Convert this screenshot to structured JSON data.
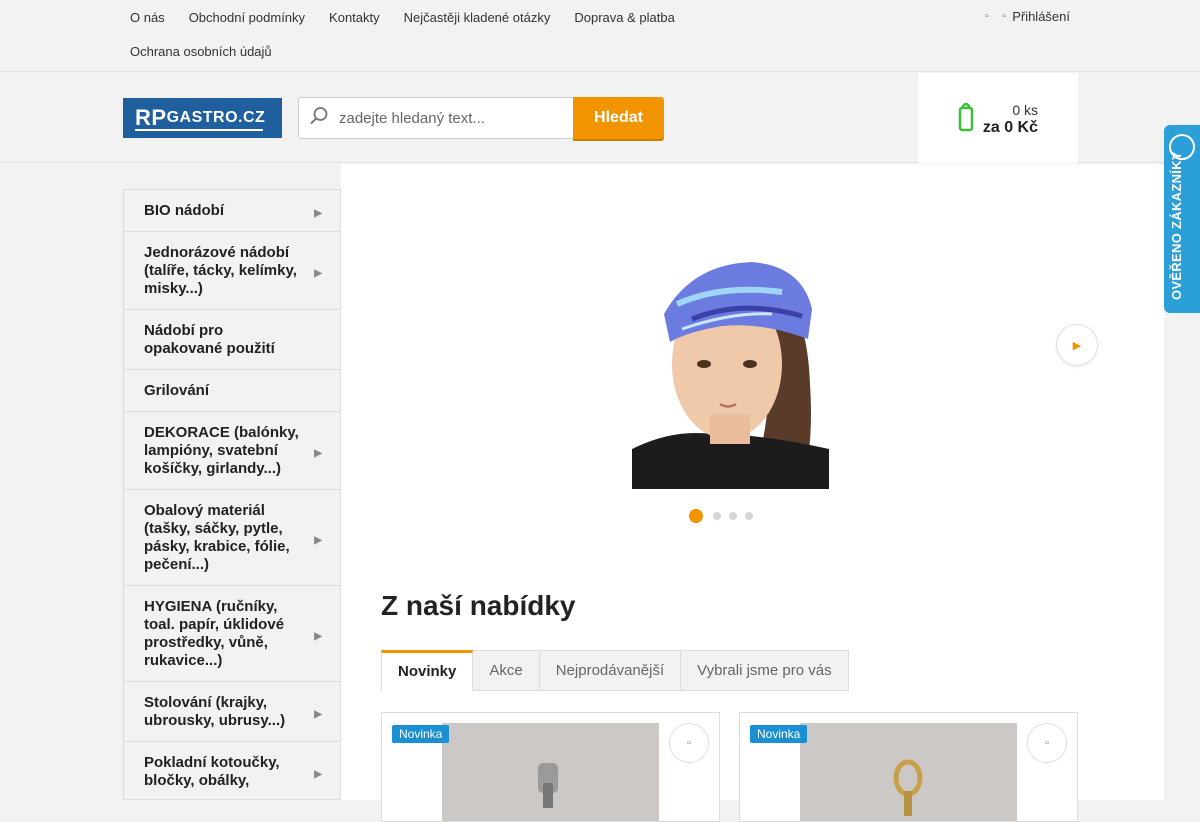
{
  "topnav": {
    "links": [
      "O nás",
      "Obchodní podmínky",
      "Kontakty",
      "Nejčastěji kladené otázky",
      "Doprava & platba",
      "Ochrana osobních údajů"
    ],
    "login_label": "Přihlášení"
  },
  "header": {
    "logo": {
      "big": "RP",
      "small": "GASTRO.CZ"
    },
    "search": {
      "placeholder": "zadejte hledaný text...",
      "button_label": "Hledat"
    },
    "cart": {
      "qty": "0 ks",
      "price": "za 0 Kč"
    }
  },
  "badge": {
    "text": "OVĚŘENO ZÁKAZNÍKY"
  },
  "sidebar": {
    "items": [
      {
        "label": "BIO nádobí",
        "has_arrow": true
      },
      {
        "label": "Jednorázové nádobí (talíře, tácky, kelímky, misky...)",
        "has_arrow": true
      },
      {
        "label": "Nádobí pro opakované použití",
        "has_arrow": false
      },
      {
        "label": "Grilování",
        "has_arrow": false
      },
      {
        "label": "DEKORACE (balónky, lampióny, svatební košíčky, girlandy...)",
        "has_arrow": true
      },
      {
        "label": "Obalový materiál (tašky, sáčky, pytle, pásky, krabice, fólie, pečení...)",
        "has_arrow": true
      },
      {
        "label": "HYGIENA (ručníky, toal. papír, úklidové prostředky, vůně, rukavice...)",
        "has_arrow": true
      },
      {
        "label": "Stolování (krajky, ubrousky, ubrusy...)",
        "has_arrow": true
      },
      {
        "label": "Pokladní kotoučky, bločky, obálky,",
        "has_arrow": true
      }
    ]
  },
  "slider": {
    "slide_count": 4,
    "active_slide": 1
  },
  "offer": {
    "title": "Z naší nabídky",
    "tabs": [
      "Novinky",
      "Akce",
      "Nejprodávanější",
      "Vybrali jsme pro vás"
    ],
    "active_tab": 0,
    "products": [
      {
        "badge": "Novinka"
      },
      {
        "badge": "Novinka"
      }
    ]
  },
  "colors": {
    "accent": "#f29400",
    "brand": "#1f5f9e",
    "badge": "#1a8fd2",
    "trust": "#2a9fd8",
    "cart_icon": "#3cbf3c"
  },
  "icons": {
    "search": "magnifier-icon",
    "login": "user-icon",
    "cart": "cart-icon",
    "next": "chevron-right-icon",
    "wishlist": "heart-icon"
  }
}
